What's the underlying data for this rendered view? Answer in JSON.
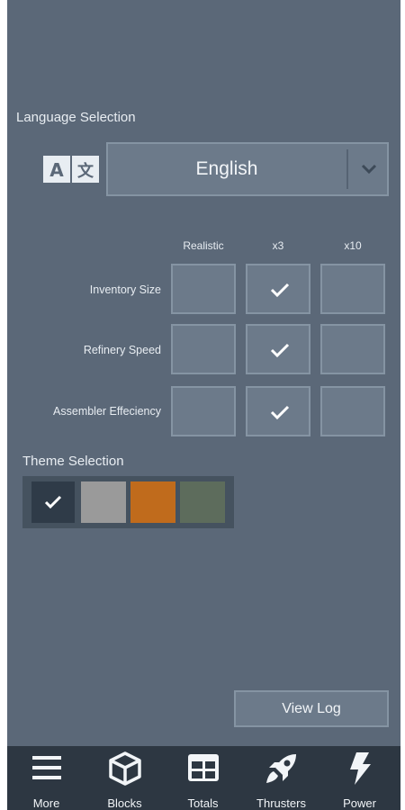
{
  "language": {
    "title": "Language Selection",
    "selected": "English",
    "icon": "translate-icon"
  },
  "multipliers": {
    "columns": [
      "Realistic",
      "x3",
      "x10"
    ],
    "rows": [
      {
        "label": "Inventory Size",
        "selected": "x3"
      },
      {
        "label": "Refinery Speed",
        "selected": "x3"
      },
      {
        "label": "Assembler Effeciency",
        "selected": "x3"
      }
    ]
  },
  "theme": {
    "title": "Theme Selection",
    "swatches": [
      {
        "name": "dark",
        "color": "#2f3b48",
        "selected": true
      },
      {
        "name": "gray",
        "color": "#9a9a9a",
        "selected": false
      },
      {
        "name": "orange",
        "color": "#c06b1c",
        "selected": false
      },
      {
        "name": "green",
        "color": "#5d6c5c",
        "selected": false
      }
    ]
  },
  "view_log_label": "View Log",
  "nav": [
    {
      "label": "More",
      "icon": "menu-icon"
    },
    {
      "label": "Blocks",
      "icon": "cube-icon"
    },
    {
      "label": "Totals",
      "icon": "grid-icon"
    },
    {
      "label": "Thrusters",
      "icon": "rocket-icon"
    },
    {
      "label": "Power",
      "icon": "lightning-icon"
    }
  ]
}
